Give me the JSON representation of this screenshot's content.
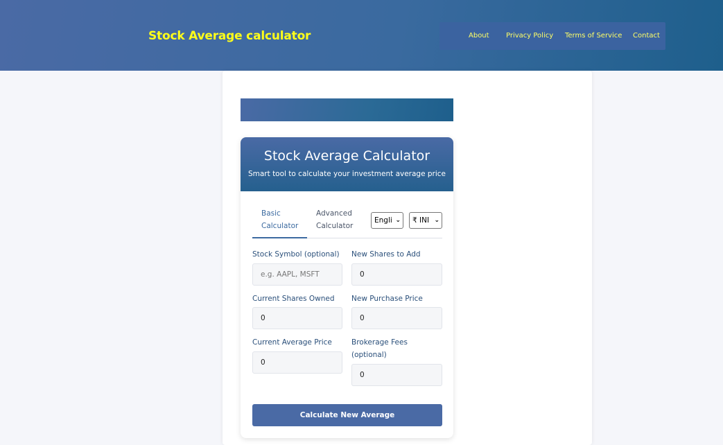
{
  "site": {
    "title": "Stock Average calculator"
  },
  "nav": {
    "items": [
      "About",
      "Privacy Policy",
      "Terms of Service",
      "Contact"
    ]
  },
  "calculator": {
    "title": "Stock Average Calculator",
    "subtitle": "Smart tool to calculate your investment average price",
    "tabs": [
      {
        "line1": "Basic",
        "line2": "Calculator",
        "active": true
      },
      {
        "line1": "Advanced",
        "line2": "Calculator",
        "active": false
      }
    ],
    "language_select": "Engli",
    "currency_select": "₹ INI",
    "fields": {
      "stock_symbol": {
        "label": "Stock Symbol (optional)",
        "placeholder": "e.g. AAPL, MSFT",
        "value": ""
      },
      "new_shares": {
        "label": "New Shares to Add",
        "value": "0"
      },
      "current_shares": {
        "label": "Current Shares Owned",
        "value": "0"
      },
      "new_price": {
        "label": "New Purchase Price",
        "value": "0"
      },
      "current_avg": {
        "label": "Current Average Price",
        "value": "0"
      },
      "brokerage": {
        "label_line1": "Brokerage Fees",
        "label_line2": "(optional)",
        "value": "0"
      }
    },
    "button_label": "Calculate New Average"
  },
  "colors": {
    "accent": "#4a6aa5",
    "title_yellow": "#ffff1a",
    "label_blue": "#2a4f7a"
  }
}
